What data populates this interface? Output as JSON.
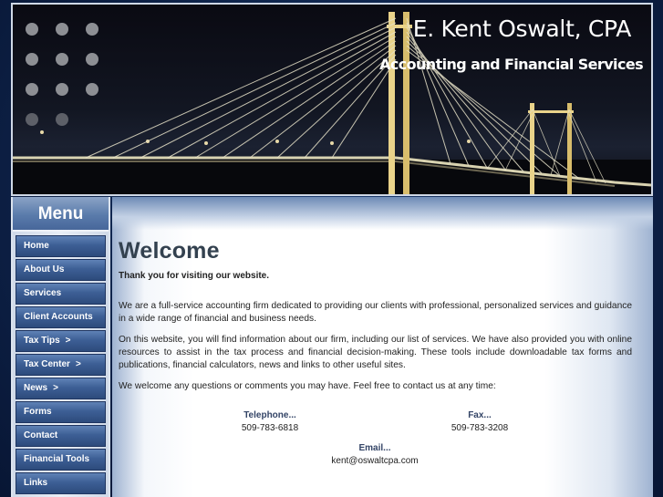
{
  "header": {
    "title": "E. Kent Oswalt, CPA",
    "subtitle": "Accounting and Financial Services"
  },
  "sidebar": {
    "title": "Menu",
    "items": [
      {
        "label": "Home",
        "arrow": ""
      },
      {
        "label": "About Us",
        "arrow": ""
      },
      {
        "label": "Services",
        "arrow": ""
      },
      {
        "label": "Client Accounts",
        "arrow": ""
      },
      {
        "label": "Tax Tips",
        "arrow": ">"
      },
      {
        "label": "Tax Center",
        "arrow": ">"
      },
      {
        "label": "News",
        "arrow": ">"
      },
      {
        "label": "Forms",
        "arrow": ""
      },
      {
        "label": "Contact",
        "arrow": ""
      },
      {
        "label": "Financial Tools",
        "arrow": ""
      },
      {
        "label": "Links",
        "arrow": ""
      }
    ]
  },
  "main": {
    "heading": "Welcome",
    "intro": "Thank you for visiting our website.",
    "paragraphs": [
      "We are a full-service accounting firm dedicated to providing our clients with professional, personalized services and guidance in a wide range of financial and business needs.",
      "On this website, you will find information about our firm, including our list of services. We have also provided you with online resources to assist in the tax process and financial decision-making. These tools include downloadable tax forms and publications, financial calculators, news and links to other useful sites.",
      "We welcome any questions or comments you may have. Feel free to contact us at any time:"
    ],
    "contact": {
      "telephone_label": "Telephone...",
      "telephone": "509-783-6818",
      "fax_label": "Fax...",
      "fax": "509-783-3208",
      "email_label": "Email...",
      "email": "kent@oswaltcpa.com"
    }
  }
}
